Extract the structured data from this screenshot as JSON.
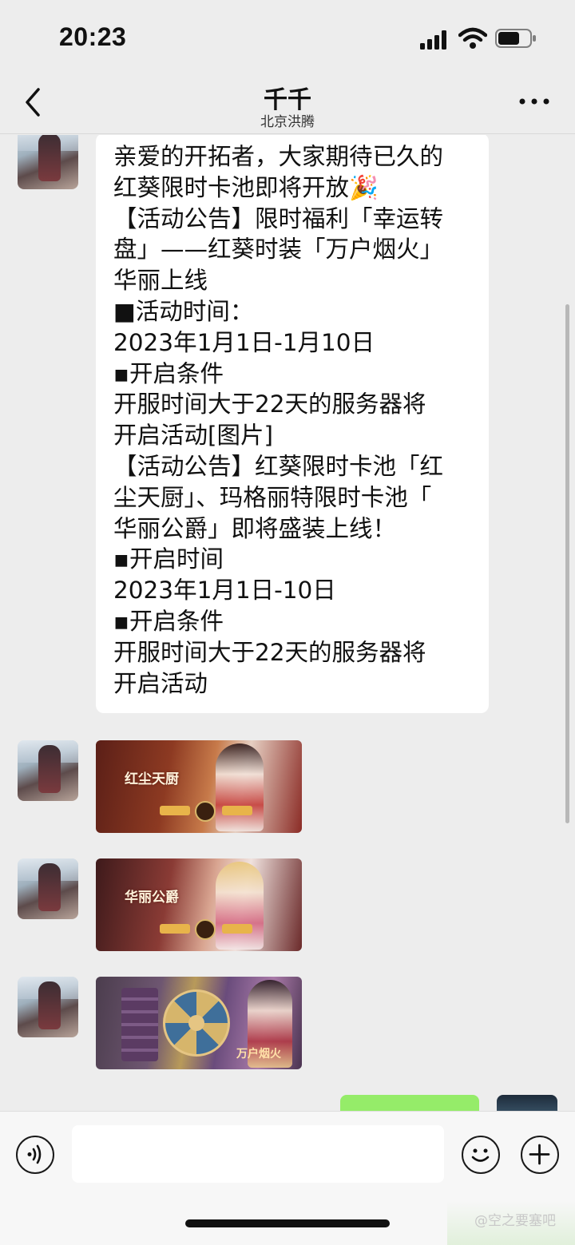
{
  "status_bar": {
    "time": "20:23"
  },
  "header": {
    "title": "千千",
    "subtitle": "北京洪腾"
  },
  "messages": {
    "announcement_lines": [
      "亲爱的开拓者，大家期待已久的",
      "红葵限时卡池即将开放🎉",
      "【活动公告】限时福利「幸运转",
      "盘」——红葵时装「万户烟火」",
      "华丽上线",
      "■活动时间：",
      "2023年1月1日-1月10日",
      "▪开启条件",
      "开服时间大于22天的服务器将",
      "开启活动[图片]",
      "【活动公告】红葵限时卡池「红",
      "尘天厨」、玛格丽特限时卡池「",
      "华丽公爵」即将盛装上线！",
      "▪开启时间",
      "2023年1月1日-10日",
      "▪开启条件",
      "开服时间大于22天的服务器将",
      "开启活动"
    ],
    "image_1_title": "红尘天厨",
    "image_2_title": "华丽公爵",
    "image_3_title": "万户烟火"
  },
  "input_bar": {
    "placeholder": ""
  },
  "watermark": "@空之要塞吧",
  "colors": {
    "background": "#ededed",
    "bubble": "#ffffff",
    "outgoing": "#95ec69"
  }
}
